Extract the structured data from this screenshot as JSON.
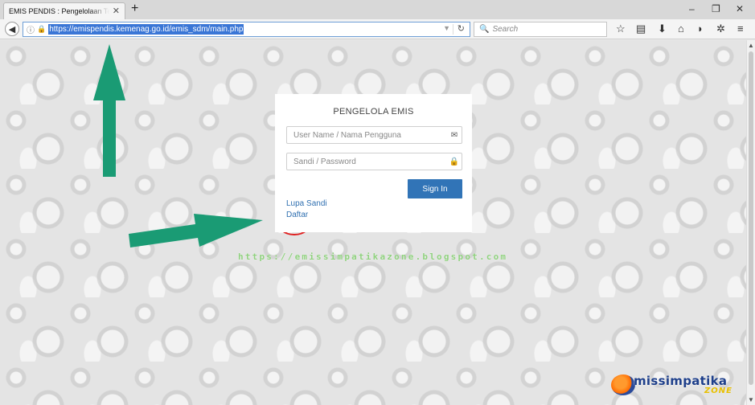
{
  "browser": {
    "tab_title": "EMIS PENDIS : Pengelolaan Tenaga",
    "tab_close": "✕",
    "new_tab": "+",
    "url": "https://emispendis.kemenag.go.id/emis_sdm/main.php",
    "search_placeholder": "Search",
    "window_controls": [
      "–",
      "❐",
      "✕"
    ],
    "toolbar_icons": [
      "star-icon",
      "reading-list-icon",
      "download-icon",
      "home-icon",
      "pocket-icon",
      "extension-icon",
      "menu-icon"
    ]
  },
  "login": {
    "title": "PENGELOLA EMIS",
    "username_placeholder": "User Name / Nama Pengguna",
    "password_placeholder": "Sandi / Password",
    "signin_label": "Sign In",
    "forgot_label": "Lupa Sandi",
    "register_label": "Daftar"
  },
  "watermark": "https://emissimpatikazone.blogspot.com",
  "logo": {
    "letter": "e",
    "text": "missimpatika",
    "sub": "ZONE"
  },
  "colors": {
    "primary_button": "#3174b7",
    "link": "#2f6fb0",
    "annotation_arrow": "#1a9b74",
    "annotation_circle": "#e02020"
  }
}
